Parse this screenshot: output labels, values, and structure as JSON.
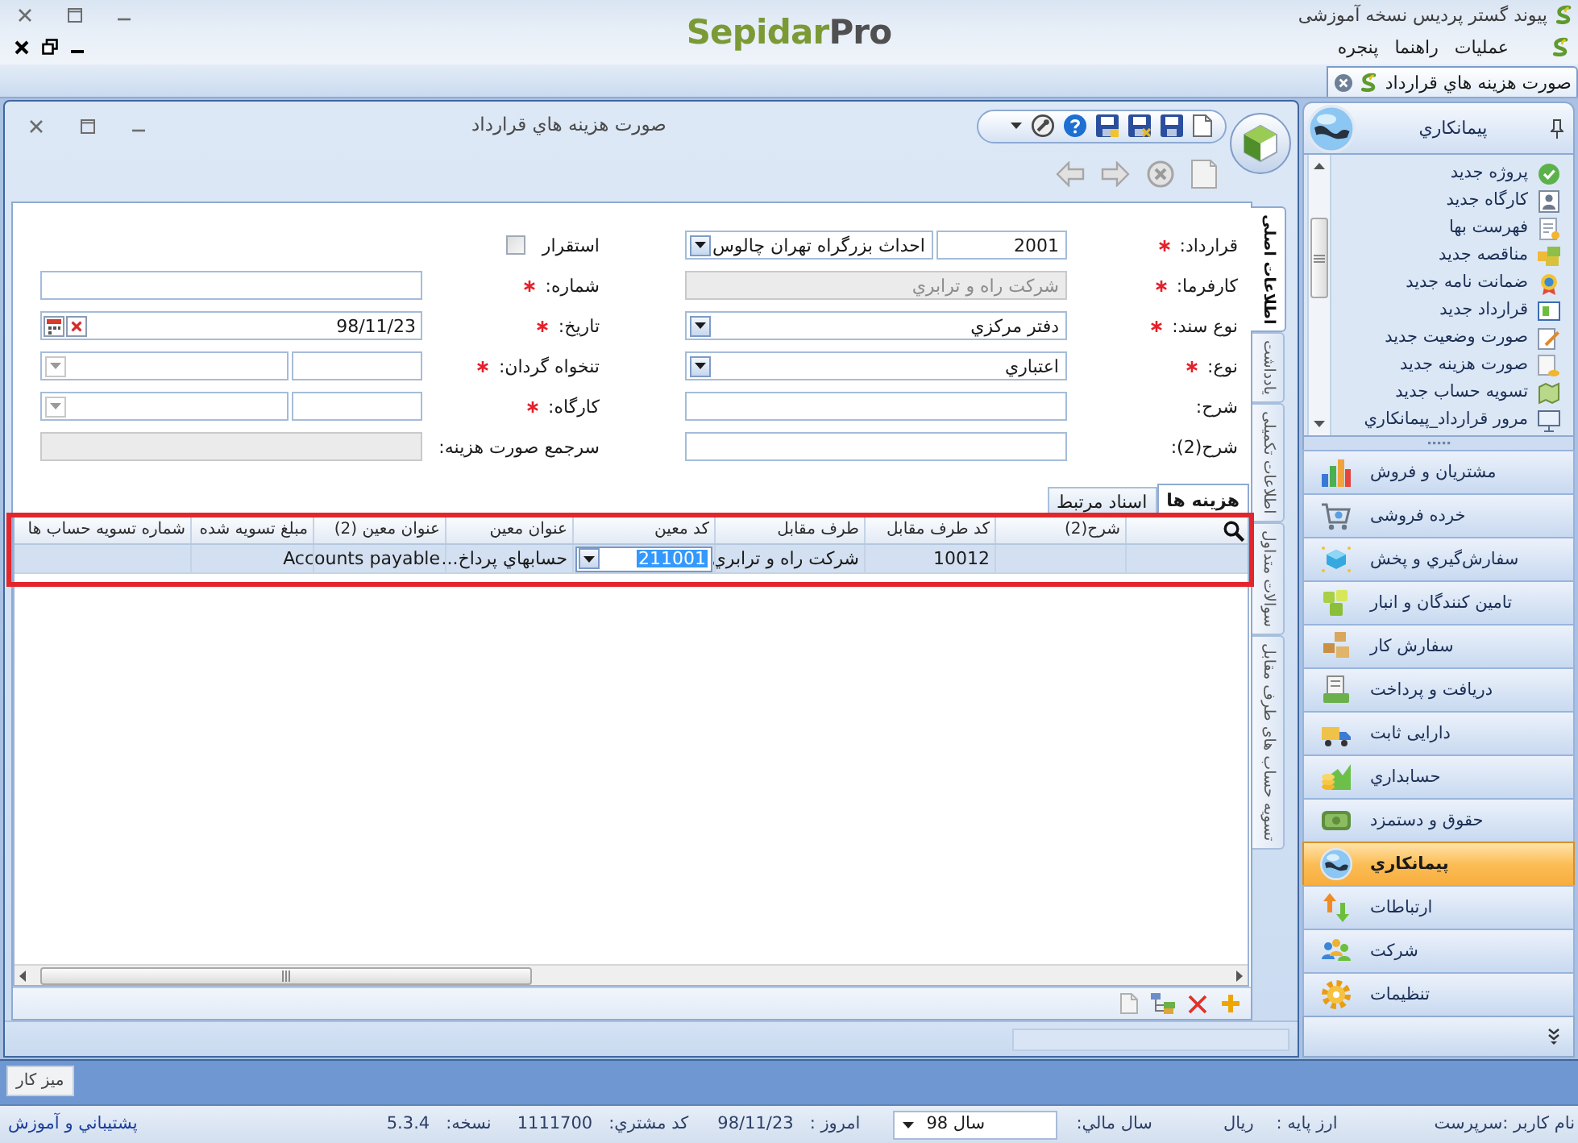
{
  "app_title_bar": {
    "title": "پیوند گستر پردیس نسخه آموزشی",
    "logo": {
      "main": "Sepidar",
      "accent": "Pro"
    }
  },
  "menu": [
    "عملیات",
    "راهنما",
    "پنجره"
  ],
  "doc_tabs": [
    {
      "label": "صورت هزینه هاي قرارداد",
      "selected": true
    }
  ],
  "document_window": {
    "title": "صورت هزینه هاي قرارداد",
    "side_tabs": [
      {
        "label": "اطلاعات اصلی",
        "selected": true
      },
      {
        "label": "یادداشت",
        "selected": false
      },
      {
        "label": "اطلاعات تکمیلی",
        "selected": false
      },
      {
        "label": "سوالات متداول",
        "selected": false
      },
      {
        "label": "تسویه حساب های طرف مقابل",
        "selected": false
      }
    ],
    "form": {
      "right_column": [
        {
          "label": "قرارداد:",
          "required": true,
          "kind": "code_combo",
          "code": "2001",
          "value": "احداث بزرگراه تهران چالوس"
        },
        {
          "label": "کارفرما:",
          "required": true,
          "kind": "text",
          "value": "شرکت راه و ترابري",
          "disabled": true
        },
        {
          "label": "نوع سند:",
          "required": true,
          "kind": "combo",
          "value": "دفتر مرکزي"
        },
        {
          "label": "نوع:",
          "required": true,
          "kind": "combo",
          "value": "اعتباري"
        },
        {
          "label": "شرح:",
          "kind": "text",
          "disabled": false
        },
        {
          "label": "شرح(2):",
          "kind": "text",
          "disabled": false
        }
      ],
      "left_column": [
        {
          "label": "استقرار",
          "kind": "checkbox",
          "checked": false
        },
        {
          "label": "شماره:",
          "required": true,
          "kind": "text",
          "disabled": false
        },
        {
          "label": "تاریخ:",
          "required": true,
          "kind": "date",
          "value": "98/11/23"
        },
        {
          "label": "تنخواه گردان:",
          "required": true,
          "kind": "code_combo"
        },
        {
          "label": "کارگاه:",
          "required": true,
          "kind": "code_combo"
        },
        {
          "label": "سرجمع صورت هزینه:",
          "kind": "text",
          "disabled": true
        }
      ]
    },
    "grid": {
      "tabs": [
        {
          "label": "هزینه ها",
          "selected": true
        },
        {
          "label": "اسناد مرتبط",
          "selected": false
        }
      ],
      "columns": [
        "شرح(2)",
        "کد طرف مقابل",
        "طرف مقابل",
        "کد معین",
        "عنوان معین",
        "عنوان معین (2)",
        "مبلغ تسویه شده",
        "شماره تسویه حساب ها"
      ],
      "rows": [
        {
          "selected": true,
          "cells": [
            {
              "kind": "text"
            },
            {
              "kind": "text",
              "text": "10012"
            },
            {
              "kind": "text",
              "text": "شرکت راه و ترابري"
            },
            {
              "kind": "editor",
              "text": "211001",
              "text_selected": true
            },
            {
              "kind": "text",
              "text": "حسابهاي پرداخ..."
            },
            {
              "kind": "text",
              "text": "Accounts payable"
            },
            {
              "kind": "text"
            },
            {
              "kind": "text"
            }
          ]
        }
      ]
    }
  },
  "sidebar": {
    "title": "پیمانکاري",
    "tasks": [
      "پروژه جدید",
      "کارگاه جدید",
      "فهرست بها",
      "مناقصه جدید",
      "ضمانت نامه جدید",
      "قرارداد جدید",
      "صورت وضعیت جدید",
      "صورت هزینه جدید",
      "تسویه حساب جدید",
      "مرور قرارداد_پیمانکاري"
    ],
    "modules": [
      {
        "label": "مشتریان و فروش",
        "selected": false
      },
      {
        "label": "خرده فروشی",
        "selected": false
      },
      {
        "label": "سفارش‌گیري و پخش",
        "selected": false
      },
      {
        "label": "تامین کنندگان و انبار",
        "selected": false
      },
      {
        "label": "سفارش کار",
        "selected": false
      },
      {
        "label": "دریافت و پرداخت",
        "selected": false
      },
      {
        "label": "دارایی ثابت",
        "selected": false
      },
      {
        "label": "حسابداري",
        "selected": false
      },
      {
        "label": "حقوق و دستمزد",
        "selected": false
      },
      {
        "label": "پیمانکاري",
        "selected": true
      },
      {
        "label": "ارتباطات",
        "selected": false
      },
      {
        "label": "شرکت",
        "selected": false
      },
      {
        "label": "تنظیمات",
        "selected": false
      }
    ]
  },
  "desktop_tab": "میز کار",
  "status_bar": {
    "user": "نام کاربر :سرپرست",
    "currency_label": "ارز پایه :",
    "currency": "ریال",
    "fiscal_year_label": "سال مالي:",
    "fiscal_year": "سال 98",
    "today_label": "امروز :",
    "today": "98/11/23",
    "customer_code_label": "کد مشتري:",
    "customer_code": "1111700",
    "version_label": "نسخه:",
    "version": "5.3.4",
    "support_link": "پشتيباني و آموزش"
  }
}
